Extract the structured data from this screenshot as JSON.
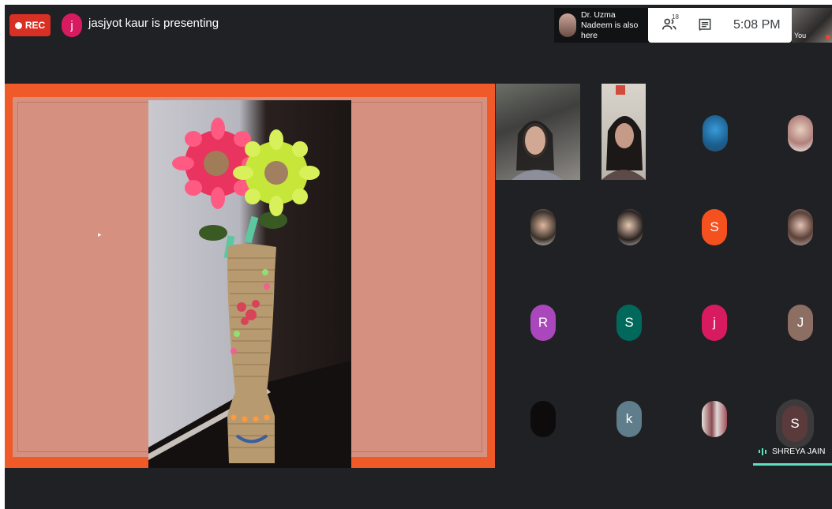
{
  "topbar": {
    "rec_label": "REC",
    "presenter_initial": "j",
    "presenter_text": "jasjyot kaur is presenting",
    "also_here_text": "Dr. Uzma Nadeem is also here",
    "participant_count": "18",
    "clock": "5:08 PM",
    "self_label": "You"
  },
  "participants": {
    "initials": {
      "s1": "S",
      "r": "R",
      "s2": "S",
      "j1": "j",
      "j2": "J",
      "k": "k",
      "s3": "S"
    },
    "speaker_name": "SHREYA JAIN"
  },
  "colors": {
    "rec": "#d93025",
    "presentation_border": "#f05a28",
    "slide_bg": "#d6907f",
    "speaker_accent": "#5ee0c0",
    "avatar_s_orange": "#f4511e",
    "avatar_r_purple": "#ab47bc",
    "avatar_s_green": "#00695c",
    "avatar_j_pink": "#d81b60",
    "avatar_j_brown": "#8d6e63",
    "avatar_k_slate": "#607d8b"
  },
  "icons": [
    "rec-dot-icon",
    "people-icon",
    "chat-icon",
    "speaking-equalizer-icon",
    "mic-off-icon"
  ]
}
